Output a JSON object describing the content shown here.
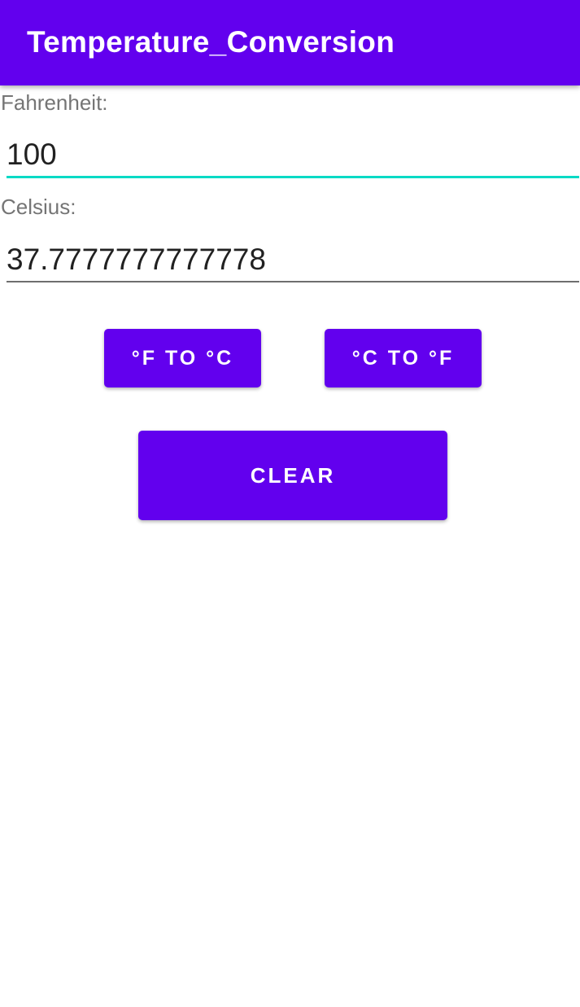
{
  "app_bar": {
    "title": "Temperature_Conversion"
  },
  "fahrenheit": {
    "label": "Fahrenheit:",
    "value": "100"
  },
  "celsius": {
    "label": "Celsius:",
    "value": "37.7777777777778"
  },
  "buttons": {
    "f_to_c": "°F TO °C",
    "c_to_f": "°C TO °F",
    "clear": "CLEAR"
  },
  "colors": {
    "primary": "#6200ee",
    "accent": "#03dac5"
  }
}
